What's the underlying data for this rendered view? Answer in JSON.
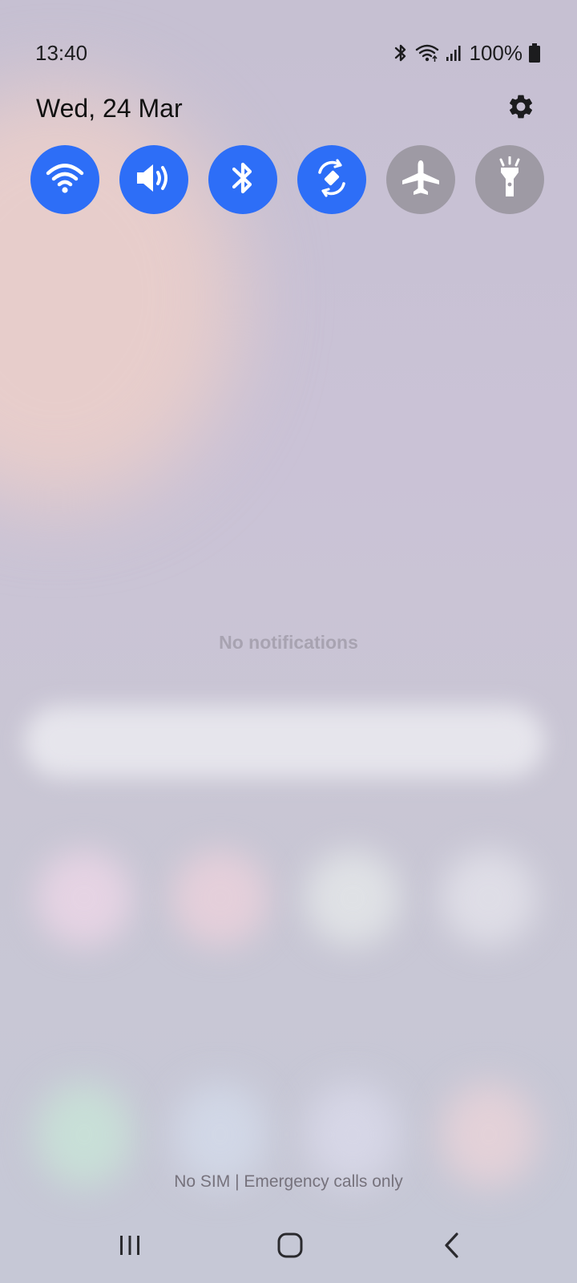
{
  "status_bar": {
    "time": "13:40",
    "battery": "100%",
    "icons": [
      "bluetooth-icon",
      "wifi-icon",
      "signal-icon",
      "battery-icon"
    ]
  },
  "header": {
    "date": "Wed, 24 Mar",
    "settings_icon": "gear-icon"
  },
  "quick_toggles": [
    {
      "name": "Wi-Fi",
      "icon": "wifi-icon",
      "state": "on"
    },
    {
      "name": "Sound",
      "icon": "speaker-icon",
      "state": "on"
    },
    {
      "name": "Bluetooth",
      "icon": "bluetooth-icon",
      "state": "on"
    },
    {
      "name": "Auto rotate",
      "icon": "rotate-icon",
      "state": "on"
    },
    {
      "name": "Aeroplane mode",
      "icon": "airplane-icon",
      "state": "off"
    },
    {
      "name": "Torch",
      "icon": "flashlight-icon",
      "state": "off"
    }
  ],
  "notifications": {
    "empty_text": "No notifications"
  },
  "footer": {
    "carrier_text": "No SIM | Emergency calls only"
  },
  "nav_bar": {
    "icons": [
      "recent-apps-icon",
      "home-icon",
      "back-icon"
    ]
  },
  "colors": {
    "toggle_on": "#2d6ef7",
    "toggle_off": "#9e9aa4"
  }
}
